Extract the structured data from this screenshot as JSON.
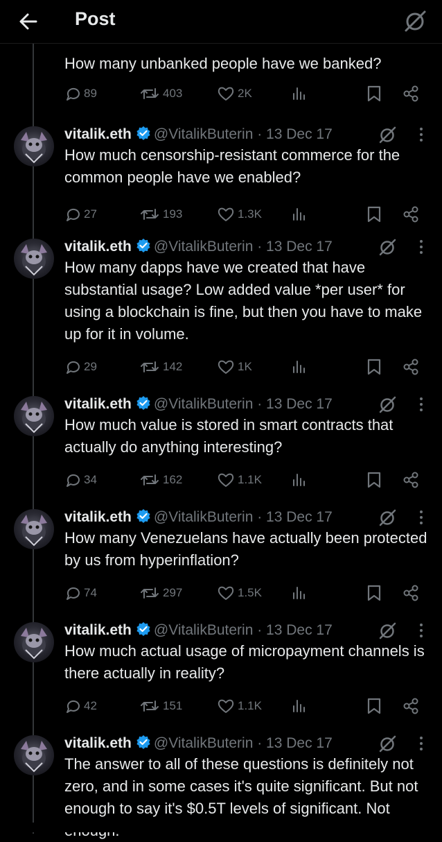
{
  "header": {
    "title": "Post"
  },
  "first_tweet": {
    "text": "How many unbanked people have we banked?",
    "replies": "89",
    "reposts": "403",
    "likes": "2K"
  },
  "tweets": [
    {
      "name": "vitalik.eth",
      "handle": "@VitalikButerin",
      "date": "· 13 Dec 17",
      "text": "How much censorship-resistant commerce for the common people have we enabled?",
      "replies": "27",
      "reposts": "193",
      "likes": "1.3K"
    },
    {
      "name": "vitalik.eth",
      "handle": "@VitalikButerin",
      "date": "· 13 Dec 17",
      "text": "How many dapps have we created that have substantial usage? Low added value *per user* for using a blockchain is fine, but then you have to make up for it in volume.",
      "replies": "29",
      "reposts": "142",
      "likes": "1K"
    },
    {
      "name": "vitalik.eth",
      "handle": "@VitalikButerin",
      "date": "· 13 Dec 17",
      "text": "How much value is stored in smart contracts that actually do anything interesting?",
      "replies": "34",
      "reposts": "162",
      "likes": "1.1K"
    },
    {
      "name": "vitalik.eth",
      "handle": "@VitalikButerin",
      "date": "· 13 Dec 17",
      "text": "How many Venezuelans have actually been protected by us from hyperinflation?",
      "replies": "74",
      "reposts": "297",
      "likes": "1.5K"
    },
    {
      "name": "vitalik.eth",
      "handle": "@VitalikButerin",
      "date": "· 13 Dec 17",
      "text": "How much actual usage of micropayment channels is there actually in reality?",
      "replies": "42",
      "reposts": "151",
      "likes": "1.1K"
    },
    {
      "name": "vitalik.eth",
      "handle": "@VitalikButerin",
      "date": "· 13 Dec 17",
      "text": "The answer to all of these questions is definitely not zero, and in some cases it's quite significant. But not enough to say it's $0.5T levels of significant. Not enough.",
      "replies": "",
      "reposts": "",
      "likes": ""
    }
  ],
  "colors": {
    "background": "#000000",
    "text": "#e7e9ea",
    "muted": "#71767b",
    "verified": "#1d9bf0"
  },
  "icons": [
    "back-arrow-icon",
    "grok-icon",
    "verified-badge-icon",
    "more-icon",
    "reply-icon",
    "repost-icon",
    "like-icon",
    "views-icon",
    "bookmark-icon",
    "share-icon"
  ]
}
